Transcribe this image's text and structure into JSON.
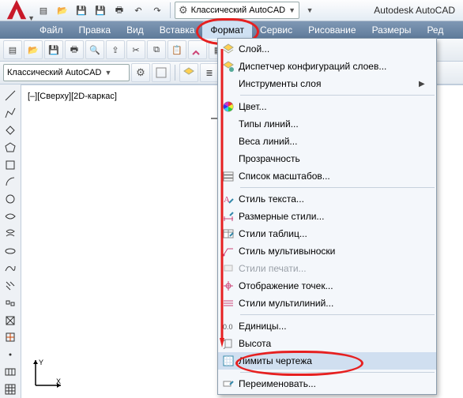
{
  "app_title": "Autodesk AutoCAD",
  "workspace_combo": "Классический AutoCAD",
  "menubar": [
    "Файл",
    "Правка",
    "Вид",
    "Вставка",
    "Формат",
    "Сервис",
    "Рисование",
    "Размеры",
    "Ред"
  ],
  "active_menu_index": 4,
  "toolbar2_combo": "Классический AutoCAD",
  "canvas_label": "[–][Сверху][2D-каркас]",
  "dropdown": {
    "groups": [
      [
        {
          "icon": "layer-icon",
          "label": "Слой...",
          "sub": false,
          "disabled": false
        },
        {
          "icon": "layer-state-icon",
          "label": "Диспетчер конфигураций слоев...",
          "sub": false,
          "disabled": false
        },
        {
          "icon": "",
          "label": "Инструменты слоя",
          "sub": true,
          "disabled": false
        }
      ],
      [
        {
          "icon": "color-wheel-icon",
          "label": "Цвет...",
          "sub": false,
          "disabled": false
        },
        {
          "icon": "",
          "label": "Типы линий...",
          "sub": false,
          "disabled": false
        },
        {
          "icon": "",
          "label": "Веса линий...",
          "sub": false,
          "disabled": false
        },
        {
          "icon": "",
          "label": "Прозрачность",
          "sub": false,
          "disabled": false
        },
        {
          "icon": "scale-list-icon",
          "label": "Список масштабов...",
          "sub": false,
          "disabled": false
        }
      ],
      [
        {
          "icon": "text-style-icon",
          "label": "Стиль текста...",
          "sub": false,
          "disabled": false
        },
        {
          "icon": "dim-style-icon",
          "label": "Размерные стили...",
          "sub": false,
          "disabled": false
        },
        {
          "icon": "table-style-icon",
          "label": "Стили таблиц...",
          "sub": false,
          "disabled": false
        },
        {
          "icon": "mleader-style-icon",
          "label": "Стиль мультивыноски",
          "sub": false,
          "disabled": false
        },
        {
          "icon": "plot-style-icon",
          "label": "Стили печати...",
          "sub": false,
          "disabled": true
        },
        {
          "icon": "point-style-icon",
          "label": "Отображение точек...",
          "sub": false,
          "disabled": false
        },
        {
          "icon": "mline-style-icon",
          "label": "Стили мультилиний...",
          "sub": false,
          "disabled": false
        }
      ],
      [
        {
          "icon": "units-icon",
          "label": "Единицы...",
          "sub": false,
          "disabled": false
        },
        {
          "icon": "thickness-icon",
          "label": "Высота",
          "sub": false,
          "disabled": false
        },
        {
          "icon": "limits-icon",
          "label": "Лимиты чертежа",
          "sub": false,
          "disabled": false,
          "highlighted": true,
          "circled": true
        }
      ],
      [
        {
          "icon": "rename-icon",
          "label": "Переименовать...",
          "sub": false,
          "disabled": false
        }
      ]
    ]
  }
}
